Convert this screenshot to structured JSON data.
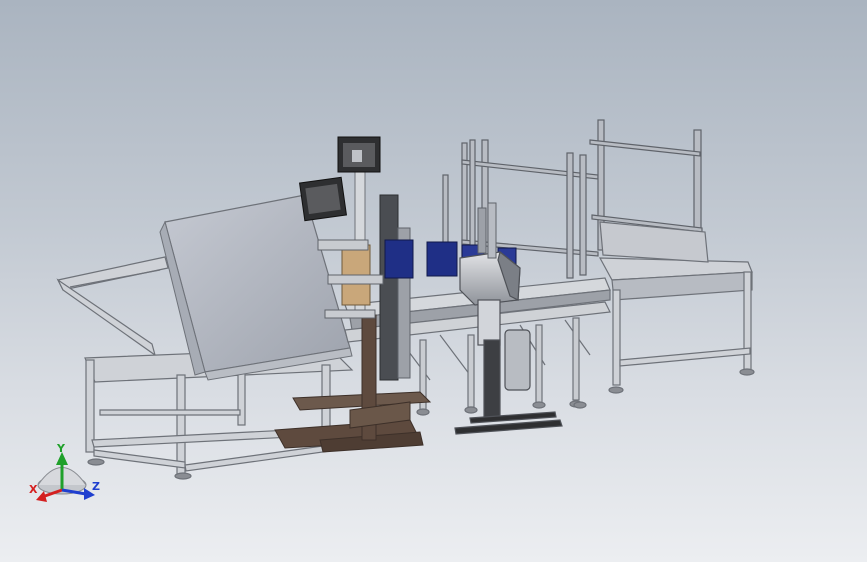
{
  "viewport": {
    "background_top": "#aab4c0",
    "background_bottom": "#eceef1"
  },
  "triad": {
    "x_label": "X",
    "y_label": "Y",
    "z_label": "Z",
    "x_color": "#d42020",
    "y_color": "#1fa02a",
    "z_color": "#1f3fcf"
  },
  "model": {
    "frame_color": "#c9ccd1",
    "frame_dark": "#7d8188",
    "panel_color": "#b5bac4",
    "wood_color": "#5e4a3e",
    "motor_color": "#1f2f86",
    "screen_color": "#3a3a3a"
  }
}
